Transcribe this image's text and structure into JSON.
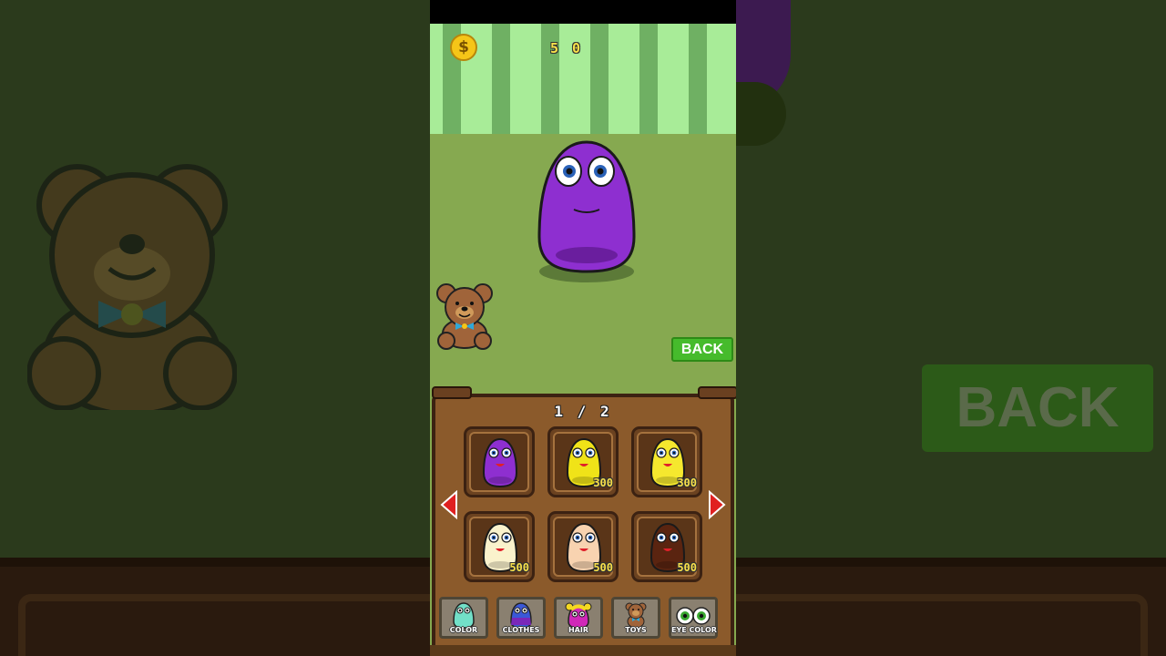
{
  "hud": {
    "coins": "5 0",
    "coin_symbol": "$"
  },
  "back_button": {
    "label": "BACK"
  },
  "background": {
    "back_label": "BACK"
  },
  "shop": {
    "page_indicator": "1 / 2",
    "items": [
      {
        "color": "#8e2fd0",
        "price": ""
      },
      {
        "color": "#f0e318",
        "price": "300"
      },
      {
        "color": "#f5e82e",
        "price": "300"
      },
      {
        "color": "#faf2cc",
        "price": "500"
      },
      {
        "color": "#f8d3b0",
        "price": "500"
      },
      {
        "color": "#5a2410",
        "price": "500"
      }
    ],
    "tabs": [
      {
        "label": "COLOR",
        "icon": "pet-mint-icon"
      },
      {
        "label": "CLOTHES",
        "icon": "pet-clothes-icon"
      },
      {
        "label": "HAIR",
        "icon": "pet-hair-icon"
      },
      {
        "label": "TOYS",
        "icon": "teddy-bear-icon"
      },
      {
        "label": "EYE COLOR",
        "icon": "eyes-icon"
      }
    ]
  },
  "colors": {
    "pet": "#8e2fd0",
    "accent_green": "#46bb2c",
    "coin_text": "#f8e04a"
  }
}
